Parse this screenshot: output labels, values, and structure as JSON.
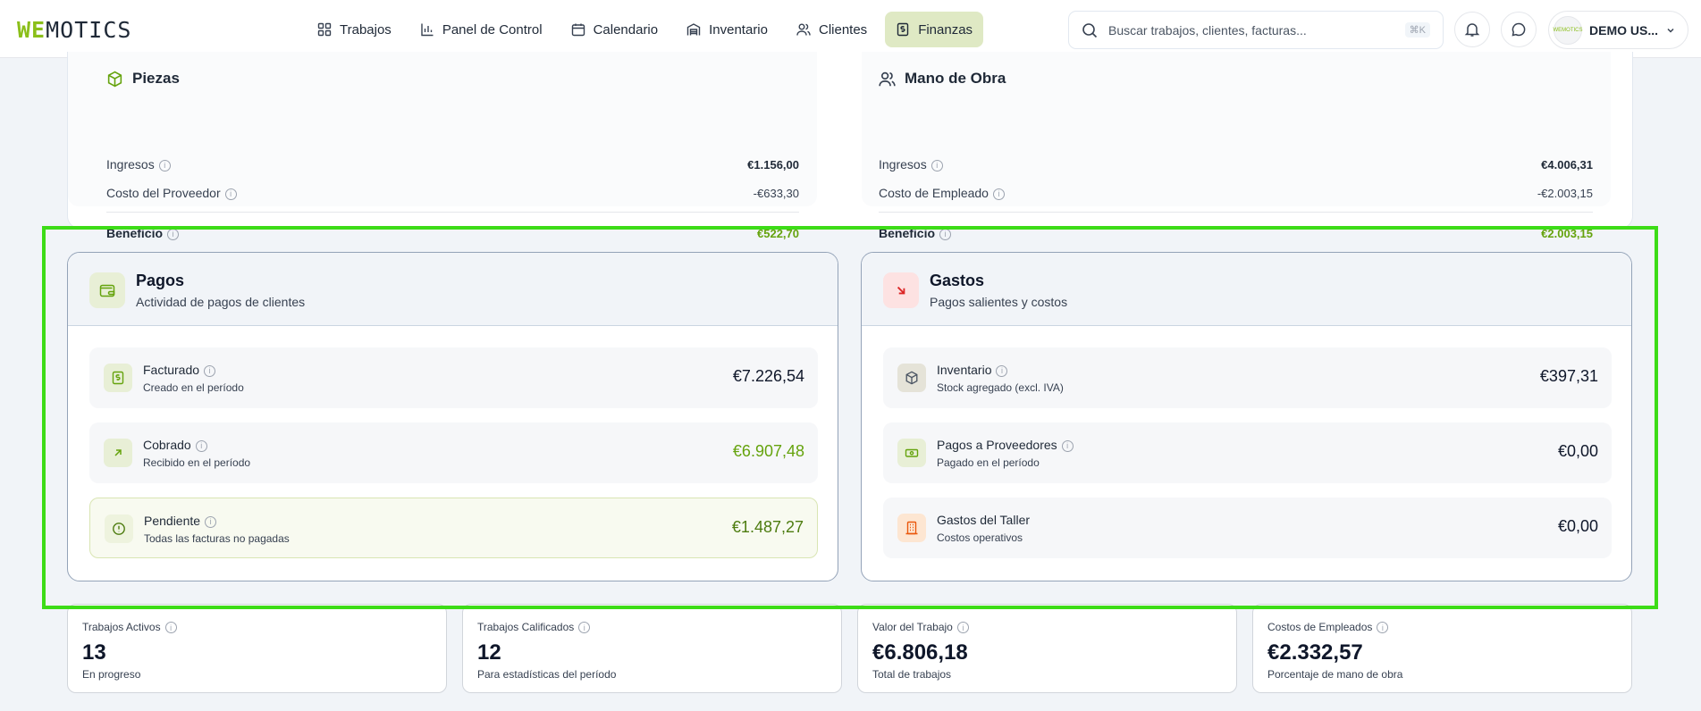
{
  "header": {
    "logo_we": "WE",
    "logo_rest": "MOTICS",
    "nav": [
      {
        "label": "Trabajos",
        "icon": "grid-icon"
      },
      {
        "label": "Panel de Control",
        "icon": "bar-chart-icon"
      },
      {
        "label": "Calendario",
        "icon": "calendar-icon"
      },
      {
        "label": "Inventario",
        "icon": "warehouse-icon"
      },
      {
        "label": "Clientes",
        "icon": "users-icon"
      },
      {
        "label": "Finanzas",
        "icon": "receipt-icon",
        "active": true
      }
    ],
    "search_placeholder": "Buscar trabajos, clientes, facturas...",
    "search_shortcut": "⌘K",
    "user_name": "DEMO US...",
    "avatar_text": "WEMOTICS"
  },
  "profit": {
    "parts": {
      "title": "Piezas",
      "income_label": "Ingresos",
      "income_value": "€1.156,00",
      "cost_label": "Costo del Proveedor",
      "cost_value": "-€633,30",
      "profit_label": "Beneficio",
      "profit_value": "€522,70"
    },
    "labor": {
      "title": "Mano de Obra",
      "income_label": "Ingresos",
      "income_value": "€4.006,31",
      "cost_label": "Costo de Empleado",
      "cost_value": "-€2.003,15",
      "profit_label": "Beneficio",
      "profit_value": "€2.003,15"
    }
  },
  "payments": {
    "title": "Pagos",
    "subtitle": "Actividad de pagos de clientes",
    "items": [
      {
        "label": "Facturado",
        "sub": "Creado en el período",
        "value": "€7.226,54"
      },
      {
        "label": "Cobrado",
        "sub": "Recibido en el período",
        "value": "€6.907,48"
      },
      {
        "label": "Pendiente",
        "sub": "Todas las facturas no pagadas",
        "value": "€1.487,27"
      }
    ]
  },
  "expenses": {
    "title": "Gastos",
    "subtitle": "Pagos salientes y costos",
    "items": [
      {
        "label": "Inventario",
        "sub": "Stock agregado (excl. IVA)",
        "value": "€397,31"
      },
      {
        "label": "Pagos a Proveedores",
        "sub": "Pagado en el período",
        "value": "€0,00"
      },
      {
        "label": "Gastos del Taller",
        "sub": "Costos operativos",
        "value": "€0,00"
      }
    ]
  },
  "stats": [
    {
      "label": "Trabajos Activos",
      "value": "13",
      "sub": "En progreso"
    },
    {
      "label": "Trabajos Calificados",
      "value": "12",
      "sub": "Para estadísticas del período"
    },
    {
      "label": "Valor del Trabajo",
      "value": "€6.806,18",
      "sub": "Total de trabajos"
    },
    {
      "label": "Costos de Empleados",
      "value": "€2.332,57",
      "sub": "Porcentaje de mano de obra"
    }
  ],
  "colors": {
    "accent_green": "#8bbf1a",
    "highlight": "#3ddc17",
    "nav_active_bg": "#dfe9c4"
  }
}
